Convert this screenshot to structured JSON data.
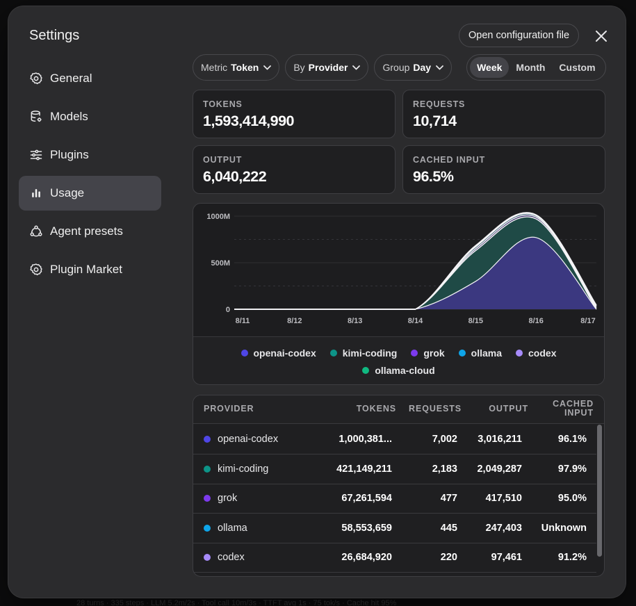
{
  "backdrop": {
    "text": "28 turns · 335 steps  ·  LLM 5.2m/2s · Tool call 10m/3s  ·  TTFT avg 1s · 75 tok/s  ·  Cache hit 95%"
  },
  "modal": {
    "title": "Settings",
    "open_config_label": "Open configuration file"
  },
  "sidebar": {
    "items": [
      {
        "label": "General",
        "icon": "gear-icon"
      },
      {
        "label": "Models",
        "icon": "database-icon"
      },
      {
        "label": "Plugins",
        "icon": "sliders-icon"
      },
      {
        "label": "Usage",
        "icon": "bar-chart-icon",
        "active": true
      },
      {
        "label": "Agent presets",
        "icon": "agents-icon"
      },
      {
        "label": "Plugin Market",
        "icon": "gear-icon"
      }
    ]
  },
  "controls": {
    "metric": {
      "label": "Metric",
      "value": "Token"
    },
    "by": {
      "label": "By",
      "value": "Provider"
    },
    "group": {
      "label": "Group",
      "value": "Day"
    },
    "range": {
      "options": [
        "Week",
        "Month",
        "Custom"
      ],
      "selected": "Week"
    }
  },
  "stats": {
    "tokens": {
      "label": "TOKENS",
      "value": "1,593,414,990"
    },
    "requests": {
      "label": "REQUESTS",
      "value": "10,714"
    },
    "output": {
      "label": "OUTPUT",
      "value": "6,040,222"
    },
    "cached": {
      "label": "CACHED INPUT",
      "value": "96.5%"
    }
  },
  "chart_data": {
    "type": "area",
    "x": [
      "8/11",
      "8/12",
      "8/13",
      "8/14",
      "8/15",
      "8/16",
      "8/17"
    ],
    "y_ticks": [
      "0",
      "500M",
      "1000M"
    ],
    "ylim": [
      0,
      1000
    ],
    "y_unit": "M",
    "stacked": true,
    "legend_placement": "bottom",
    "grid": true,
    "series": [
      {
        "name": "openai-codex",
        "color": "#4f46e5",
        "values": [
          0,
          0,
          0,
          0,
          300,
          770,
          0
        ]
      },
      {
        "name": "kimi-coding",
        "color": "#0d9488",
        "values": [
          0,
          0,
          0,
          0,
          330,
          200,
          0
        ]
      },
      {
        "name": "grok",
        "color": "#7c3aed",
        "values": [
          0,
          0,
          0,
          0,
          20,
          20,
          15
        ]
      },
      {
        "name": "ollama",
        "color": "#0ea5e9",
        "values": [
          0,
          0,
          0,
          0,
          20,
          15,
          15
        ]
      },
      {
        "name": "codex",
        "color": "#a78bfa",
        "values": [
          0,
          0,
          0,
          0,
          10,
          5,
          10
        ]
      },
      {
        "name": "ollama-cloud",
        "color": "#10b981",
        "values": [
          0,
          0,
          0,
          0,
          5,
          5,
          5
        ]
      }
    ]
  },
  "table": {
    "headers": {
      "provider": "PROVIDER",
      "tokens": "TOKENS",
      "requests": "REQUESTS",
      "output": "OUTPUT",
      "cached_1": "CACHED",
      "cached_2": "INPUT"
    },
    "rows": [
      {
        "name": "openai-codex",
        "color": "#4f46e5",
        "tokens": "1,000,381...",
        "requests": "7,002",
        "output": "3,016,211",
        "cached": "96.1%"
      },
      {
        "name": "kimi-coding",
        "color": "#0d9488",
        "tokens": "421,149,211",
        "requests": "2,183",
        "output": "2,049,287",
        "cached": "97.9%"
      },
      {
        "name": "grok",
        "color": "#7c3aed",
        "tokens": "67,261,594",
        "requests": "477",
        "output": "417,510",
        "cached": "95.0%"
      },
      {
        "name": "ollama",
        "color": "#0ea5e9",
        "tokens": "58,553,659",
        "requests": "445",
        "output": "247,403",
        "cached": "Unknown"
      },
      {
        "name": "codex",
        "color": "#a78bfa",
        "tokens": "26,684,920",
        "requests": "220",
        "output": "97,461",
        "cached": "91.2%"
      }
    ]
  }
}
